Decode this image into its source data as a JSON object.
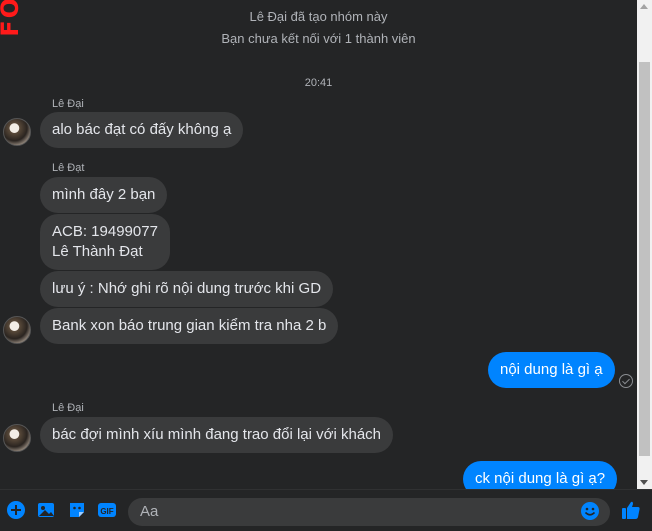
{
  "system": {
    "group_created": "Lê Đại đã tạo nhóm này",
    "not_connected": "Bạn chưa kết nối với 1 thành viên"
  },
  "time_divider": "20:41",
  "messages": [
    {
      "sender": "Lê Đại",
      "text": "alo bác đạt có đấy không ạ",
      "direction": "in"
    },
    {
      "sender": "Lê Đạt",
      "text": "mình đây 2 bạn",
      "direction": "in"
    },
    {
      "text_line1": "ACB: 19499077",
      "text_line2": "Lê Thành Đạt",
      "direction": "in"
    },
    {
      "text": "lưu ý : Nhớ ghi rõ nội dung trước khi GD",
      "direction": "in"
    },
    {
      "text": "Bank xon báo trung gian kiểm tra nha 2 b",
      "direction": "in"
    },
    {
      "text": "nội dung là gì ạ",
      "direction": "out"
    },
    {
      "sender": "Lê Đại",
      "text": "bác đợi mình xíu mình đang trao đổi lại với khách",
      "direction": "in"
    },
    {
      "text": "ck nội dung là gì ạ?",
      "direction": "out"
    }
  ],
  "composer": {
    "placeholder": "Aa",
    "icons": [
      "plus-circle-icon",
      "photo-icon",
      "sticker-icon",
      "gif-icon",
      "emoji-icon",
      "thumbs-up-icon"
    ],
    "gif_label": "GIF"
  },
  "colors": {
    "background": "#242526",
    "incoming_bubble": "#3a3b3c",
    "outgoing_bubble": "#0084ff",
    "accent": "#0084ff",
    "logo": "#ff1a1a"
  },
  "logo_text": "FO"
}
